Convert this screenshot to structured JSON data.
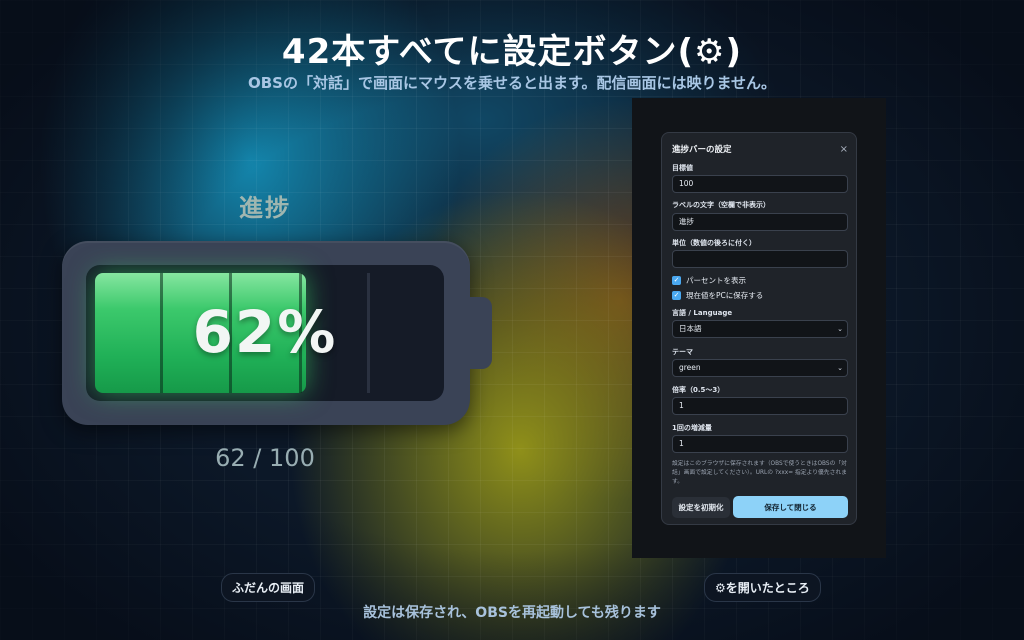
{
  "header": {
    "title": "42本すべてに設定ボタン(⚙)",
    "subtitle": "OBSの「対話」で画面にマウスを乗せると出ます。配信画面には映りません。"
  },
  "footer": {
    "text": "設定は保存され、OBSを再起動しても残ります"
  },
  "left_preview": {
    "label": "進捗",
    "percent_text": "62%",
    "count_text": "62 / 100",
    "progress_fraction": 0.62,
    "fill_color": "#22b85a",
    "caption": "ふだんの画面"
  },
  "right_preview": {
    "caption": "⚙を開いたところ",
    "dialog": {
      "title": "進捗バーの設定",
      "close": "×",
      "target_label": "目標値",
      "target_value": "100",
      "label_text_label": "ラベルの文字（空欄で非表示）",
      "label_text_value": "進捗",
      "unit_label": "単位（数値の後ろに付く）",
      "unit_value": "",
      "show_percent_label": "パーセントを表示",
      "save_to_pc_label": "現在値をPCに保存する",
      "language_label": "言語 / Language",
      "language_value": "日本語",
      "theme_label": "テーマ",
      "theme_value": "green",
      "scale_label": "倍率（0.5〜3）",
      "scale_value": "1",
      "step_label": "1回の増減量",
      "step_value": "1",
      "note": "設定はこのブラウザに保存されます（OBSで使うときはOBSの「対話」画面で設定してください）。URLの ?xxx= 指定より優先されます。",
      "reset_button": "設定を初期化",
      "save_button": "保存して閉じる"
    }
  }
}
